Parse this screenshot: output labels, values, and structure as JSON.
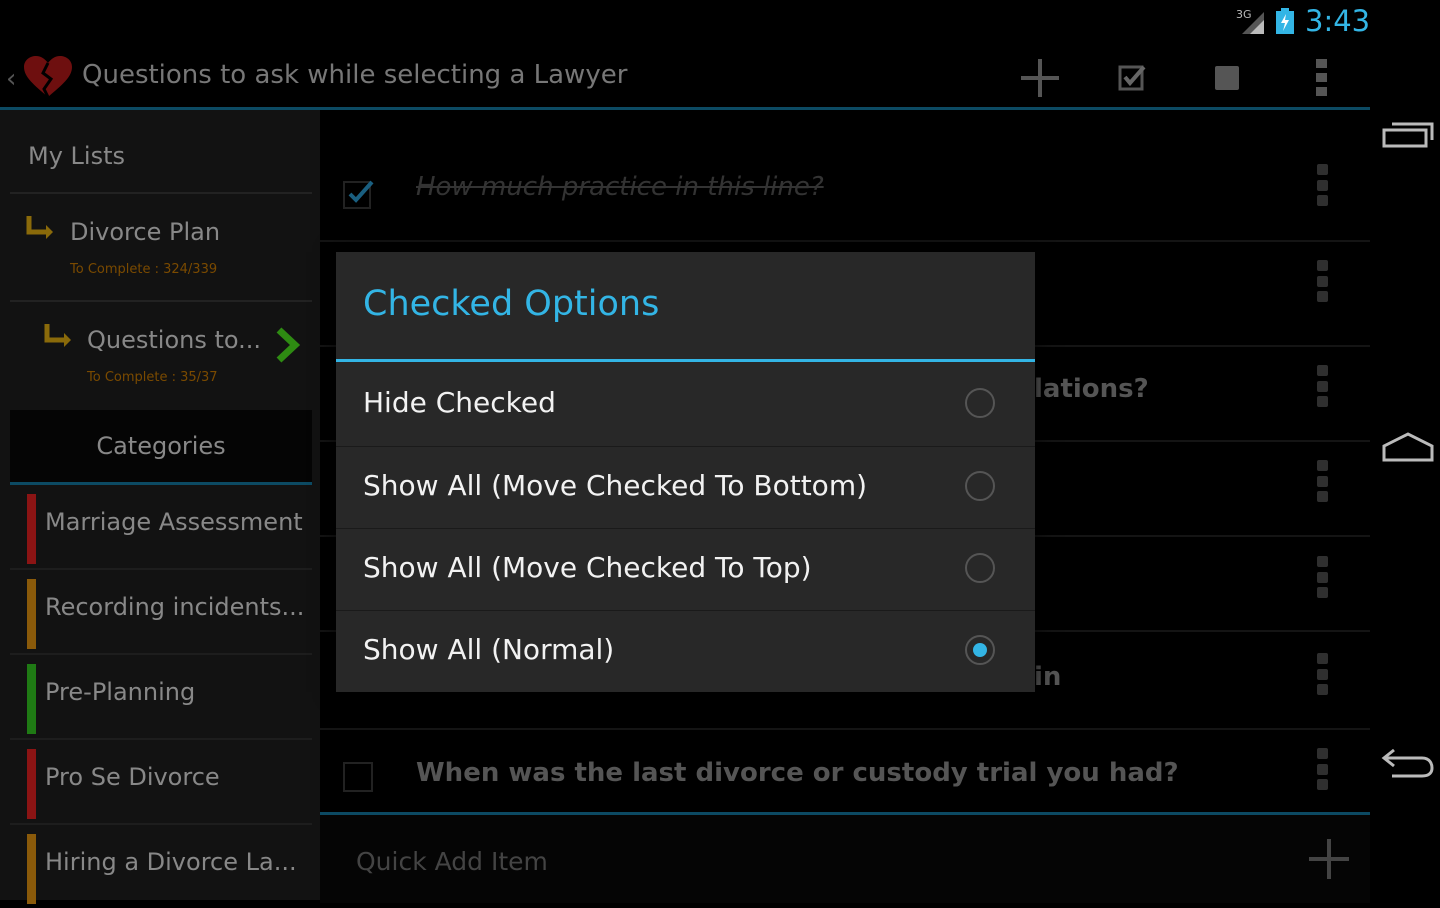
{
  "status_bar": {
    "network": "3G",
    "time": "3:43"
  },
  "action_bar": {
    "title": "Questions to ask while selecting a Lawyer",
    "actions": [
      "add-icon",
      "check-box-icon",
      "stop-square-icon",
      "overflow-menu-icon"
    ]
  },
  "sidebar": {
    "header": "My Lists",
    "lists": [
      {
        "name": "Divorce Plan",
        "sub": "To Complete : 324/339"
      },
      {
        "name": "Questions to...",
        "sub": "To Complete : 35/37"
      }
    ],
    "categories_title": "Categories",
    "categories": [
      {
        "label": "Marriage Assessment",
        "color": "#8b1414"
      },
      {
        "label": "Recording incidents...",
        "color": "#8a5a0a"
      },
      {
        "label": "Pre-Planning",
        "color": "#1f7a14"
      },
      {
        "label": "Pro Se Divorce",
        "color": "#8b1414"
      },
      {
        "label": "Hiring a Divorce La...",
        "color": "#8a5a0a"
      }
    ]
  },
  "main": {
    "items": [
      {
        "text": "How much practice in this line?",
        "checked": true
      },
      {
        "text": "",
        "checked": false
      },
      {
        "text": "lations?",
        "checked": false
      },
      {
        "text": "",
        "checked": false
      },
      {
        "text": "",
        "checked": false
      },
      {
        "text": "in",
        "checked": false
      },
      {
        "text": "When was the last divorce or custody trial you had?",
        "checked": false
      }
    ],
    "quick_add_placeholder": "Quick Add Item"
  },
  "dialog": {
    "title": "Checked Options",
    "options": [
      {
        "label": "Hide Checked",
        "selected": false
      },
      {
        "label": "Show All (Move Checked To Bottom)",
        "selected": false
      },
      {
        "label": "Show All (Move Checked To Top)",
        "selected": false
      },
      {
        "label": "Show All (Normal)",
        "selected": true
      }
    ]
  },
  "colors": {
    "accent": "#33b5e5",
    "background": "#000000",
    "dialog": "#282828"
  }
}
